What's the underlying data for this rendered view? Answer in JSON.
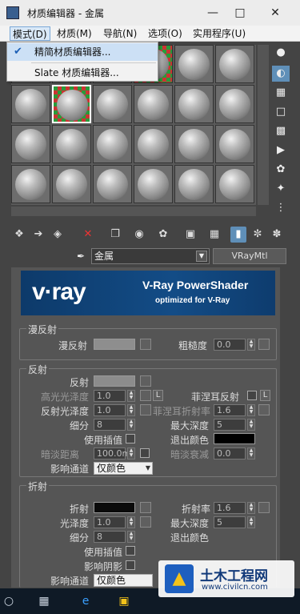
{
  "window": {
    "title": "材质编辑器 - 金属",
    "minimize_icon": "minimize-icon",
    "maximize_icon": "maximize-icon",
    "close_icon": "close-icon"
  },
  "menubar": {
    "items": [
      "模式(D)",
      "材质(M)",
      "导航(N)",
      "选项(O)",
      "实用程序(U)"
    ]
  },
  "mode_menu": {
    "items": [
      {
        "label": "精简材质编辑器...",
        "checked": true
      },
      {
        "label": "Slate 材质编辑器...",
        "checked": false
      }
    ]
  },
  "toolbar": {
    "icons": [
      "get-material-icon",
      "put-to-scene-icon",
      "assign-to-selection-icon",
      "reset-icon",
      "copy-material-icon",
      "make-unique-icon",
      "put-to-library-icon",
      "material-id-channel-icon",
      "show-shaded-icon",
      "show-end-result-icon",
      "go-to-parent-icon",
      "go-forward-sibling-icon"
    ]
  },
  "side_tools": {
    "icons": [
      "sample-type-icon",
      "backlight-icon",
      "background-icon",
      "uv-tiling-icon",
      "video-color-check-icon",
      "make-preview-icon",
      "options-icon",
      "select-by-material-icon",
      "material-navigator-icon"
    ]
  },
  "material": {
    "name": "金属",
    "type": "VRayMtl"
  },
  "banner": {
    "logo": "v·ray",
    "line1": "V-Ray PowerShader",
    "line2": "optimized for V-Ray"
  },
  "diffuse": {
    "title": "漫反射",
    "diffuse_label": "漫反射",
    "roughness_label": "粗糙度",
    "roughness_value": "0.0",
    "diffuse_color": "#8e8e8e"
  },
  "reflection": {
    "title": "反射",
    "reflect_label": "反射",
    "reflect_color": "#8c8c8c",
    "hilight_gloss_label": "高光光泽度",
    "hilight_gloss_value": "1.0",
    "lock_label": "L",
    "fresnel_label": "菲涅耳反射",
    "refl_gloss_label": "反射光泽度",
    "refl_gloss_value": "1.0",
    "fresnel_ior_label": "菲涅耳折射率",
    "fresnel_ior_value": "1.6",
    "subdivs_label": "细分",
    "subdivs_value": "8",
    "max_depth_label": "最大深度",
    "max_depth_value": "5",
    "use_interp_label": "使用插值",
    "exit_color_label": "退出颜色",
    "exit_color": "#000000",
    "dim_distance_label": "暗淡距离",
    "dim_distance_value": "100.0m",
    "dim_falloff_label": "暗淡衰减",
    "dim_falloff_value": "0.0",
    "affect_channels_label": "影响通道",
    "affect_channels_value": "仅颜色"
  },
  "refraction": {
    "title": "折射",
    "refract_label": "折射",
    "refract_color": "#0a0a0a",
    "ior_label": "折射率",
    "ior_value": "1.6",
    "gloss_label": "光泽度",
    "gloss_value": "1.0",
    "max_depth_label": "最大深度",
    "max_depth_value": "5",
    "subdivs_label": "细分",
    "subdivs_value": "8",
    "exit_color_label": "退出颜色",
    "use_interp_label": "使用插值",
    "affect_shadows_label": "影响阴影",
    "affect_channels_label": "影响通道",
    "affect_channels_value": "仅颜色"
  },
  "watermark": {
    "title": "土木工程网",
    "url": "www.civilcn.com"
  }
}
